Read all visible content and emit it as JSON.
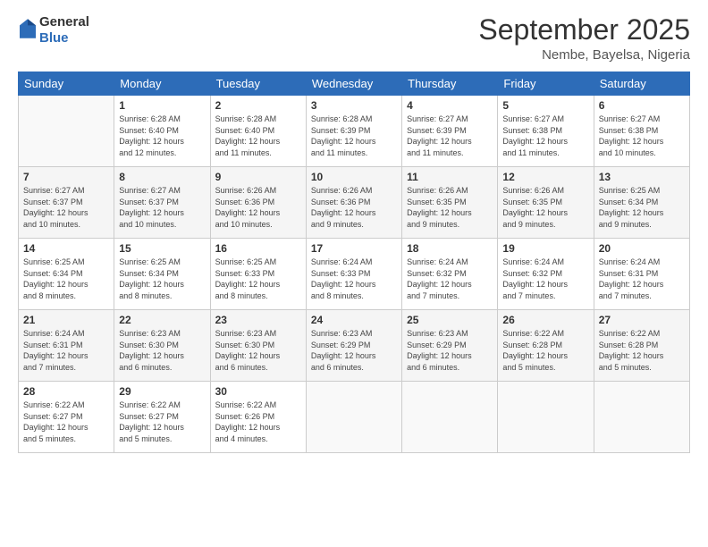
{
  "header": {
    "logo_line1": "General",
    "logo_line2": "Blue",
    "month": "September 2025",
    "location": "Nembe, Bayelsa, Nigeria"
  },
  "weekdays": [
    "Sunday",
    "Monday",
    "Tuesday",
    "Wednesday",
    "Thursday",
    "Friday",
    "Saturday"
  ],
  "weeks": [
    [
      {
        "day": "",
        "info": ""
      },
      {
        "day": "1",
        "info": "Sunrise: 6:28 AM\nSunset: 6:40 PM\nDaylight: 12 hours\nand 12 minutes."
      },
      {
        "day": "2",
        "info": "Sunrise: 6:28 AM\nSunset: 6:40 PM\nDaylight: 12 hours\nand 11 minutes."
      },
      {
        "day": "3",
        "info": "Sunrise: 6:28 AM\nSunset: 6:39 PM\nDaylight: 12 hours\nand 11 minutes."
      },
      {
        "day": "4",
        "info": "Sunrise: 6:27 AM\nSunset: 6:39 PM\nDaylight: 12 hours\nand 11 minutes."
      },
      {
        "day": "5",
        "info": "Sunrise: 6:27 AM\nSunset: 6:38 PM\nDaylight: 12 hours\nand 11 minutes."
      },
      {
        "day": "6",
        "info": "Sunrise: 6:27 AM\nSunset: 6:38 PM\nDaylight: 12 hours\nand 10 minutes."
      }
    ],
    [
      {
        "day": "7",
        "info": "Sunrise: 6:27 AM\nSunset: 6:37 PM\nDaylight: 12 hours\nand 10 minutes."
      },
      {
        "day": "8",
        "info": "Sunrise: 6:27 AM\nSunset: 6:37 PM\nDaylight: 12 hours\nand 10 minutes."
      },
      {
        "day": "9",
        "info": "Sunrise: 6:26 AM\nSunset: 6:36 PM\nDaylight: 12 hours\nand 10 minutes."
      },
      {
        "day": "10",
        "info": "Sunrise: 6:26 AM\nSunset: 6:36 PM\nDaylight: 12 hours\nand 9 minutes."
      },
      {
        "day": "11",
        "info": "Sunrise: 6:26 AM\nSunset: 6:35 PM\nDaylight: 12 hours\nand 9 minutes."
      },
      {
        "day": "12",
        "info": "Sunrise: 6:26 AM\nSunset: 6:35 PM\nDaylight: 12 hours\nand 9 minutes."
      },
      {
        "day": "13",
        "info": "Sunrise: 6:25 AM\nSunset: 6:34 PM\nDaylight: 12 hours\nand 9 minutes."
      }
    ],
    [
      {
        "day": "14",
        "info": "Sunrise: 6:25 AM\nSunset: 6:34 PM\nDaylight: 12 hours\nand 8 minutes."
      },
      {
        "day": "15",
        "info": "Sunrise: 6:25 AM\nSunset: 6:34 PM\nDaylight: 12 hours\nand 8 minutes."
      },
      {
        "day": "16",
        "info": "Sunrise: 6:25 AM\nSunset: 6:33 PM\nDaylight: 12 hours\nand 8 minutes."
      },
      {
        "day": "17",
        "info": "Sunrise: 6:24 AM\nSunset: 6:33 PM\nDaylight: 12 hours\nand 8 minutes."
      },
      {
        "day": "18",
        "info": "Sunrise: 6:24 AM\nSunset: 6:32 PM\nDaylight: 12 hours\nand 7 minutes."
      },
      {
        "day": "19",
        "info": "Sunrise: 6:24 AM\nSunset: 6:32 PM\nDaylight: 12 hours\nand 7 minutes."
      },
      {
        "day": "20",
        "info": "Sunrise: 6:24 AM\nSunset: 6:31 PM\nDaylight: 12 hours\nand 7 minutes."
      }
    ],
    [
      {
        "day": "21",
        "info": "Sunrise: 6:24 AM\nSunset: 6:31 PM\nDaylight: 12 hours\nand 7 minutes."
      },
      {
        "day": "22",
        "info": "Sunrise: 6:23 AM\nSunset: 6:30 PM\nDaylight: 12 hours\nand 6 minutes."
      },
      {
        "day": "23",
        "info": "Sunrise: 6:23 AM\nSunset: 6:30 PM\nDaylight: 12 hours\nand 6 minutes."
      },
      {
        "day": "24",
        "info": "Sunrise: 6:23 AM\nSunset: 6:29 PM\nDaylight: 12 hours\nand 6 minutes."
      },
      {
        "day": "25",
        "info": "Sunrise: 6:23 AM\nSunset: 6:29 PM\nDaylight: 12 hours\nand 6 minutes."
      },
      {
        "day": "26",
        "info": "Sunrise: 6:22 AM\nSunset: 6:28 PM\nDaylight: 12 hours\nand 5 minutes."
      },
      {
        "day": "27",
        "info": "Sunrise: 6:22 AM\nSunset: 6:28 PM\nDaylight: 12 hours\nand 5 minutes."
      }
    ],
    [
      {
        "day": "28",
        "info": "Sunrise: 6:22 AM\nSunset: 6:27 PM\nDaylight: 12 hours\nand 5 minutes."
      },
      {
        "day": "29",
        "info": "Sunrise: 6:22 AM\nSunset: 6:27 PM\nDaylight: 12 hours\nand 5 minutes."
      },
      {
        "day": "30",
        "info": "Sunrise: 6:22 AM\nSunset: 6:26 PM\nDaylight: 12 hours\nand 4 minutes."
      },
      {
        "day": "",
        "info": ""
      },
      {
        "day": "",
        "info": ""
      },
      {
        "day": "",
        "info": ""
      },
      {
        "day": "",
        "info": ""
      }
    ]
  ]
}
